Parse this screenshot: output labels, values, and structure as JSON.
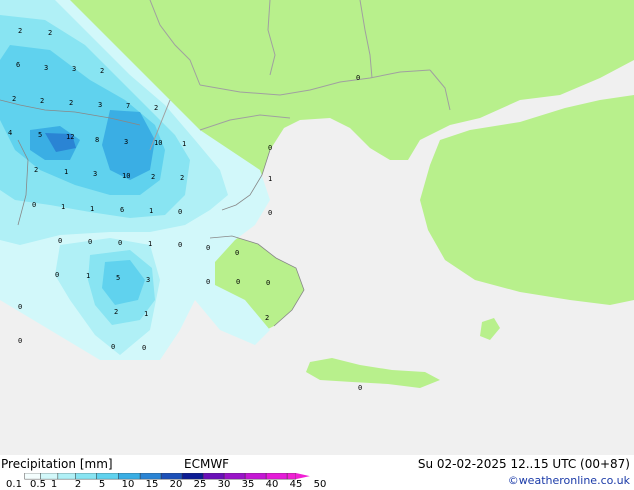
{
  "footer": {
    "title": "Precipitation [mm]",
    "model": "ECMWF",
    "datetime": "Su 02-02-2025 12..15 UTC (00+87)",
    "credit": "©weatheronline.co.uk"
  },
  "legend": {
    "ticks": [
      "0.1",
      "0.5",
      "1",
      "2",
      "5",
      "10",
      "15",
      "20",
      "25",
      "30",
      "35",
      "40",
      "45",
      "50"
    ],
    "colors": [
      "#f4fefe",
      "#d2f8fa",
      "#b0f0f6",
      "#88e4f2",
      "#60d2ee",
      "#3aaee4",
      "#2a84d4",
      "#1c50b8",
      "#0c1c94",
      "#6a10b8",
      "#9a14c8",
      "#c418d4",
      "#e41cd8",
      "#f020d4"
    ]
  },
  "map_colors": {
    "sea": "#f0f0f0",
    "land": "#b8f08c",
    "border": "#a0a0a0",
    "coast": "#888888"
  },
  "map_labels": [
    {
      "text": "2"
    },
    {
      "text": "2"
    },
    {
      "text": "6"
    },
    {
      "text": "3"
    },
    {
      "text": "3"
    },
    {
      "text": "2"
    },
    {
      "text": "2"
    },
    {
      "text": "2"
    },
    {
      "text": "2"
    },
    {
      "text": "3"
    },
    {
      "text": "7"
    },
    {
      "text": "2"
    },
    {
      "text": "4"
    },
    {
      "text": "5"
    },
    {
      "text": "12"
    },
    {
      "text": "8"
    },
    {
      "text": "3"
    },
    {
      "text": "10"
    },
    {
      "text": "1"
    },
    {
      "text": "2"
    },
    {
      "text": "1"
    },
    {
      "text": "3"
    },
    {
      "text": "10"
    },
    {
      "text": "2"
    },
    {
      "text": "2"
    },
    {
      "text": "0"
    },
    {
      "text": "1"
    },
    {
      "text": "1"
    },
    {
      "text": "6"
    },
    {
      "text": "1"
    },
    {
      "text": "0"
    },
    {
      "text": "0"
    },
    {
      "text": "0"
    },
    {
      "text": "0"
    },
    {
      "text": "1"
    },
    {
      "text": "0"
    },
    {
      "text": "0"
    },
    {
      "text": "1"
    },
    {
      "text": "5"
    },
    {
      "text": "3"
    },
    {
      "text": "0"
    },
    {
      "text": "2"
    },
    {
      "text": "1"
    },
    {
      "text": "0"
    },
    {
      "text": "0"
    },
    {
      "text": "0"
    },
    {
      "text": "0"
    },
    {
      "text": "0"
    },
    {
      "text": "2"
    },
    {
      "text": "0"
    },
    {
      "text": "0"
    },
    {
      "text": "0"
    },
    {
      "text": "0"
    },
    {
      "text": "1"
    },
    {
      "text": "0"
    }
  ]
}
